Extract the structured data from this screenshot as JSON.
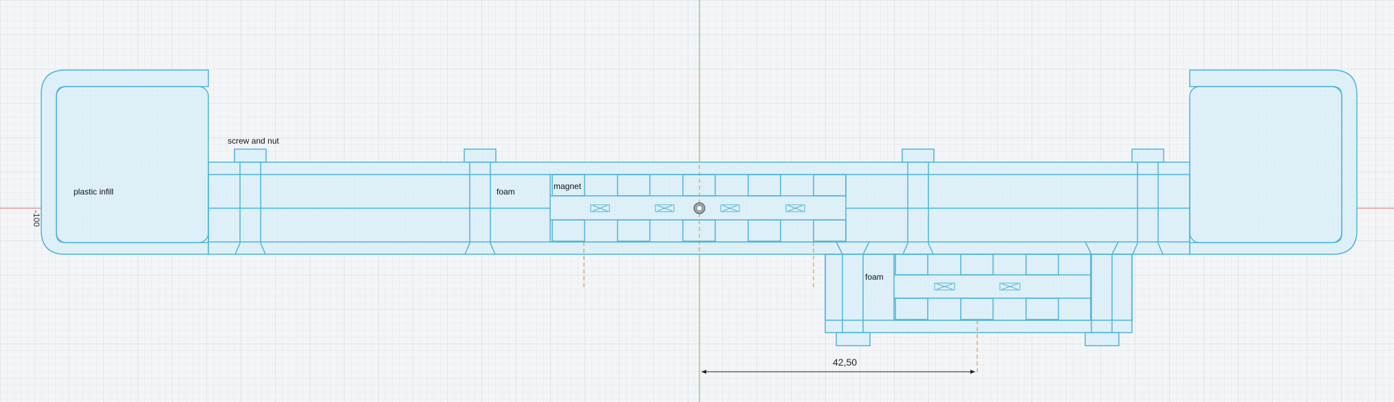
{
  "labels": {
    "plastic_infill": "plastic infill",
    "screw_and_nut": "screw and nut",
    "foam_main": "foam",
    "magnet": "magnet",
    "foam_lower": "foam"
  },
  "dimension": {
    "value": "42,50"
  },
  "axis_marker": "-100",
  "colors": {
    "background": "#f3f5f7",
    "grid_minor": "#e4e8ec",
    "grid_major": "#d2d8de",
    "outline": "#4cb3d9",
    "fill": "#dff0f8",
    "axis_vertical": "#58b858",
    "axis_horizontal": "#e07070",
    "centerline": "#d9892b",
    "dimension": "#222222"
  }
}
